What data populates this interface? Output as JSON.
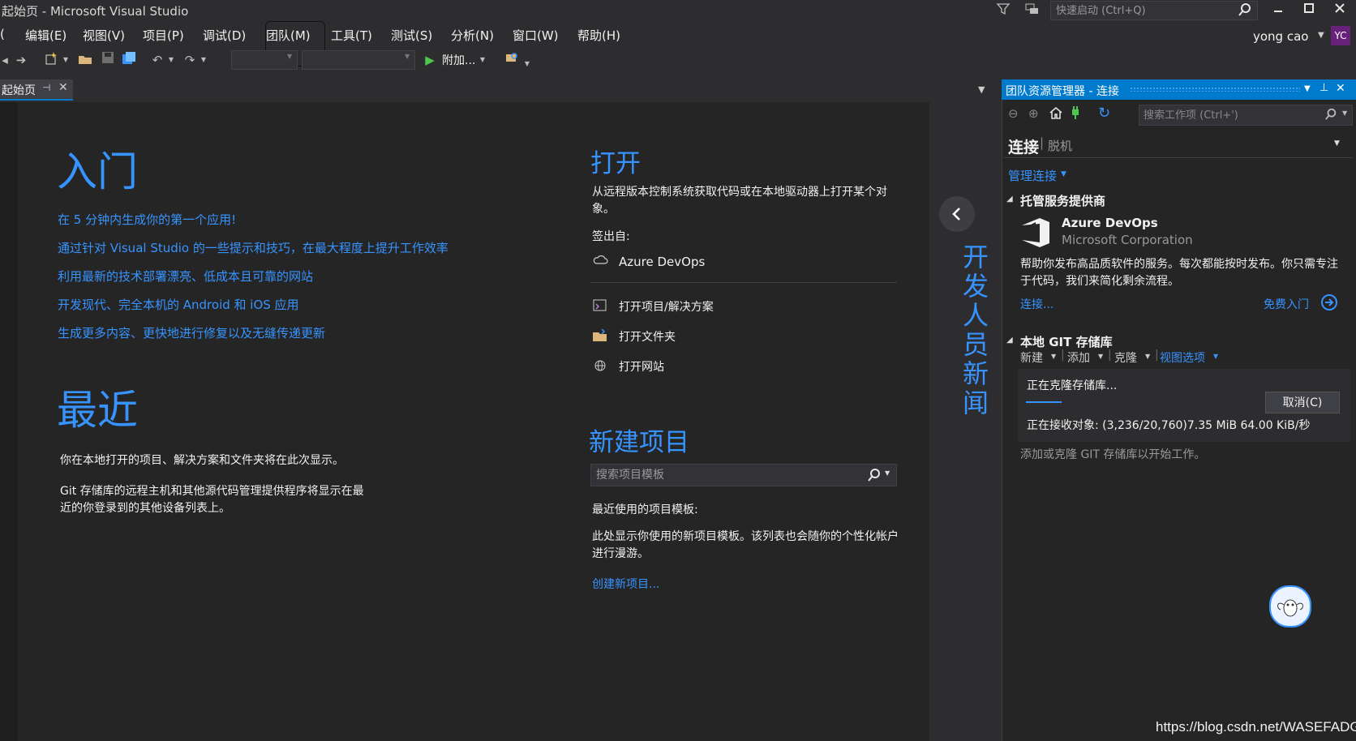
{
  "window": {
    "title": "起始页 - Microsoft Visual Studio",
    "quick_launch_placeholder": "快速启动 (Ctrl+Q)"
  },
  "menu": [
    "(",
    "编辑(E)",
    "视图(V)",
    "项目(P)",
    "调试(D)",
    "团队(M)",
    "工具(T)",
    "测试(S)",
    "分析(N)",
    "窗口(W)",
    "帮助(H)"
  ],
  "user": {
    "name": "yong cao",
    "initials": "YC"
  },
  "toolbar": {
    "attach_label": "附加..."
  },
  "doc_tab": {
    "label": "起始页"
  },
  "start_page": {
    "get_started": {
      "heading": "入门",
      "links": [
        "在 5 分钟内生成你的第一个应用!",
        "通过针对 Visual Studio 的一些提示和技巧，在最大程度上提升工作效率",
        "利用最新的技术部署漂亮、低成本且可靠的网站",
        "开发现代、完全本机的 Android 和 iOS 应用",
        "生成更多内容、更快地进行修复以及无缝传递更新"
      ]
    },
    "recent": {
      "heading": "最近",
      "text1": "你在本地打开的项目、解决方案和文件夹将在此次显示。",
      "text2": "Git 存储库的远程主机和其他源代码管理提供程序将显示在最近的你登录到的其他设备列表上。"
    },
    "open": {
      "heading": "打开",
      "description": "从远程版本控制系统获取代码或在本地驱动器上打开某个对象。",
      "checkout_label": "签出自:",
      "checkout_item": "Azure DevOps",
      "items": [
        "打开项目/解决方案",
        "打开文件夹",
        "打开网站"
      ]
    },
    "new_project": {
      "heading": "新建项目",
      "search_placeholder": "搜索项目模板",
      "recent_label": "最近使用的项目模板:",
      "recent_text": "此处显示你使用的新项目模板。该列表也会随你的个性化帐户进行漫游。",
      "create_link": "创建新项目..."
    },
    "news": {
      "label": "开发人员新闻"
    }
  },
  "team_explorer": {
    "title": "团队资源管理器 - 连接",
    "search_placeholder": "搜索工作项 (Ctrl+')",
    "header": "连接",
    "header_sub": "脱机",
    "manage_connections": "管理连接",
    "hosted_section": "托管服务提供商",
    "provider_name": "Azure DevOps",
    "provider_company": "Microsoft Corporation",
    "provider_desc": "帮助你发布高品质软件的服务。每次都能按时发布。你只需专注于代码，我们来简化剩余流程。",
    "connect_link": "连接...",
    "free_start_link": "免费入门",
    "git_section": "本地 GIT 存储库",
    "git_actions": [
      "新建",
      "添加",
      "克隆",
      "视图选项"
    ],
    "cloning_status": "正在克隆存储库...",
    "cancel_label": "取消(C)",
    "receiving_status": "正在接收对象: (3,236/20,760)7.35 MiB 64.00 KiB/秒",
    "add_clone_hint": "添加或克隆 GIT 存储库以开始工作。"
  },
  "watermark": "https://blog.csdn.net/WASEFADG",
  "colors": {
    "accent": "#007acc",
    "link": "#3794ff",
    "background": "#2d2d30",
    "panel": "#252526"
  }
}
